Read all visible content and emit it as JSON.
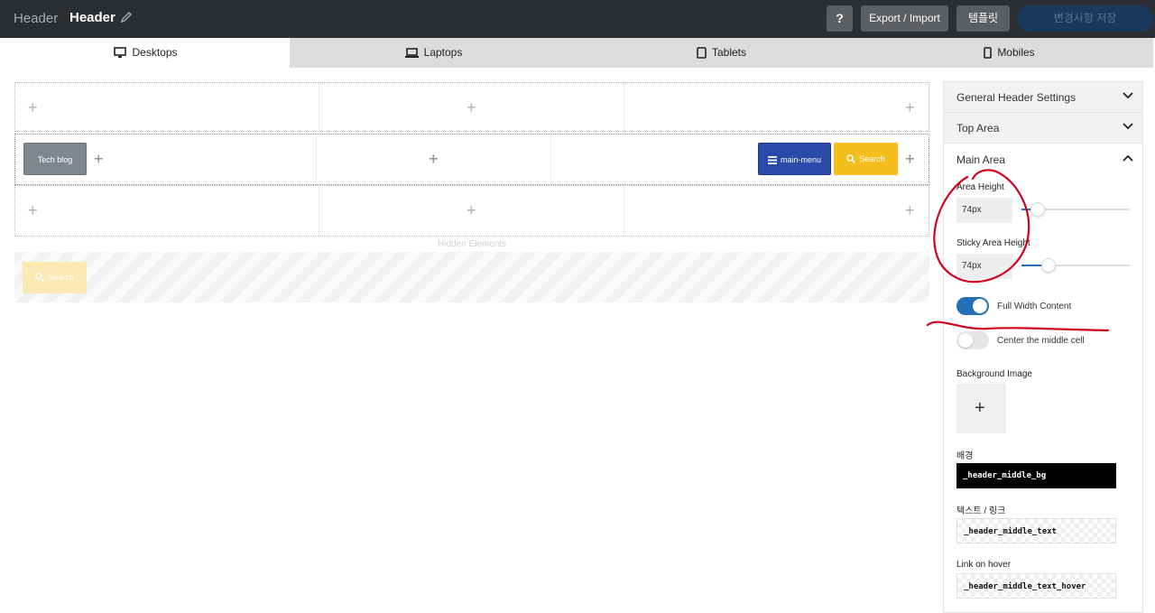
{
  "topbar": {
    "breadcrumb": "Header",
    "title": "Header",
    "help_label": "?",
    "export_label": "Export / Import",
    "template_label": "템플릿",
    "save_label": "변경사항 저장"
  },
  "tabs": [
    {
      "label": "Desktops",
      "icon": "desktop-icon",
      "active": true
    },
    {
      "label": "Laptops",
      "icon": "laptop-icon",
      "active": false
    },
    {
      "label": "Tablets",
      "icon": "tablet-icon",
      "active": false
    },
    {
      "label": "Mobiles",
      "icon": "mobile-icon",
      "active": false
    }
  ],
  "canvas": {
    "blog_chip": "Tech blog",
    "menu_chip": "main-menu",
    "search_chip": "Search",
    "hidden_label": "Hidden Elements",
    "hidden_search_chip": "Search",
    "add_symbol": "+"
  },
  "panel": {
    "sections": {
      "general": "General Header Settings",
      "top": "Top Area",
      "main": "Main Area"
    },
    "area_height_label": "Area Height",
    "area_height_value": "74px",
    "sticky_height_label": "Sticky Area Height",
    "sticky_height_value": "74px",
    "full_width_label": "Full Width Content",
    "full_width_on": true,
    "center_middle_label": "Center the middle cell",
    "center_middle_on": false,
    "bg_image_label": "Background Image",
    "bg_add_symbol": "+",
    "bg_label": "배경",
    "bg_value": "_header_middle_bg",
    "text_link_label": "텍스트 / 링크",
    "text_link_value": "_header_middle_text",
    "hover_label": "Link on hover",
    "hover_value": "_header_middle_text_hover"
  },
  "colors": {
    "topbar": "#2b2f33",
    "accent": "#2471b8",
    "menu_chip": "#2a4aa8",
    "search_chip": "#f4be1f",
    "annotation": "#d0021b"
  }
}
